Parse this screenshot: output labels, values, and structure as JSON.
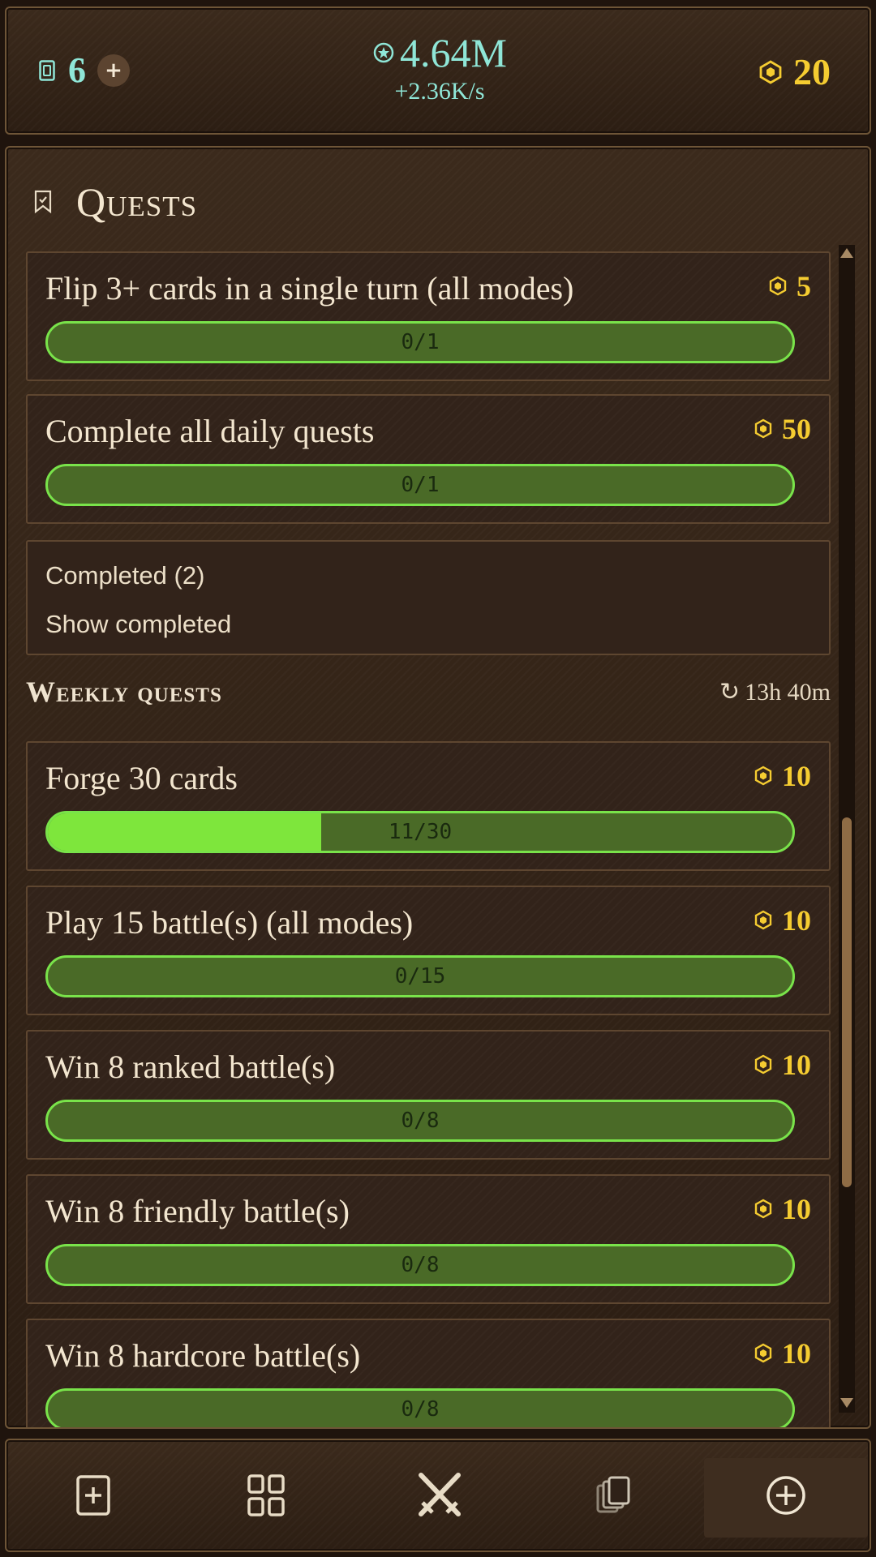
{
  "header": {
    "cards_count": "6",
    "essence_amount": "4.64M",
    "essence_rate": "+2.36K/s",
    "gold_amount": "20"
  },
  "quests_title": "Quests",
  "daily_quests": [
    {
      "title": "Flip 3+ cards in a single turn (all modes)",
      "reward": "5",
      "progress_text": "0/1",
      "progress": 0
    },
    {
      "title": "Complete all daily quests",
      "reward": "50",
      "progress_text": "0/1",
      "progress": 0
    }
  ],
  "completed": {
    "count_label": "Completed (2)",
    "toggle_label": "Show completed"
  },
  "weekly": {
    "title": "Weekly quests",
    "timer": "13h 40m",
    "quests": [
      {
        "title": "Forge 30 cards",
        "reward": "10",
        "progress_text": "11/30",
        "progress": 0.3667
      },
      {
        "title": "Play 15 battle(s) (all modes)",
        "reward": "10",
        "progress_text": "0/15",
        "progress": 0
      },
      {
        "title": "Win 8 ranked battle(s)",
        "reward": "10",
        "progress_text": "0/8",
        "progress": 0
      },
      {
        "title": "Win 8 friendly battle(s)",
        "reward": "10",
        "progress_text": "0/8",
        "progress": 0
      },
      {
        "title": "Win 8 hardcore battle(s)",
        "reward": "10",
        "progress_text": "0/8",
        "progress": 0
      }
    ]
  },
  "nav": {
    "items": [
      "add-card-icon",
      "grid-icon",
      "crossed-swords-icon",
      "card-stack-icon",
      "plus-circle-icon"
    ],
    "active": "plus-circle-icon"
  },
  "colors": {
    "essence": "#8fe6d7",
    "gold": "#f5cc31",
    "progress_border": "#79e34a",
    "progress_fill": "#7ee63c",
    "progress_track": "#4a6a27"
  }
}
